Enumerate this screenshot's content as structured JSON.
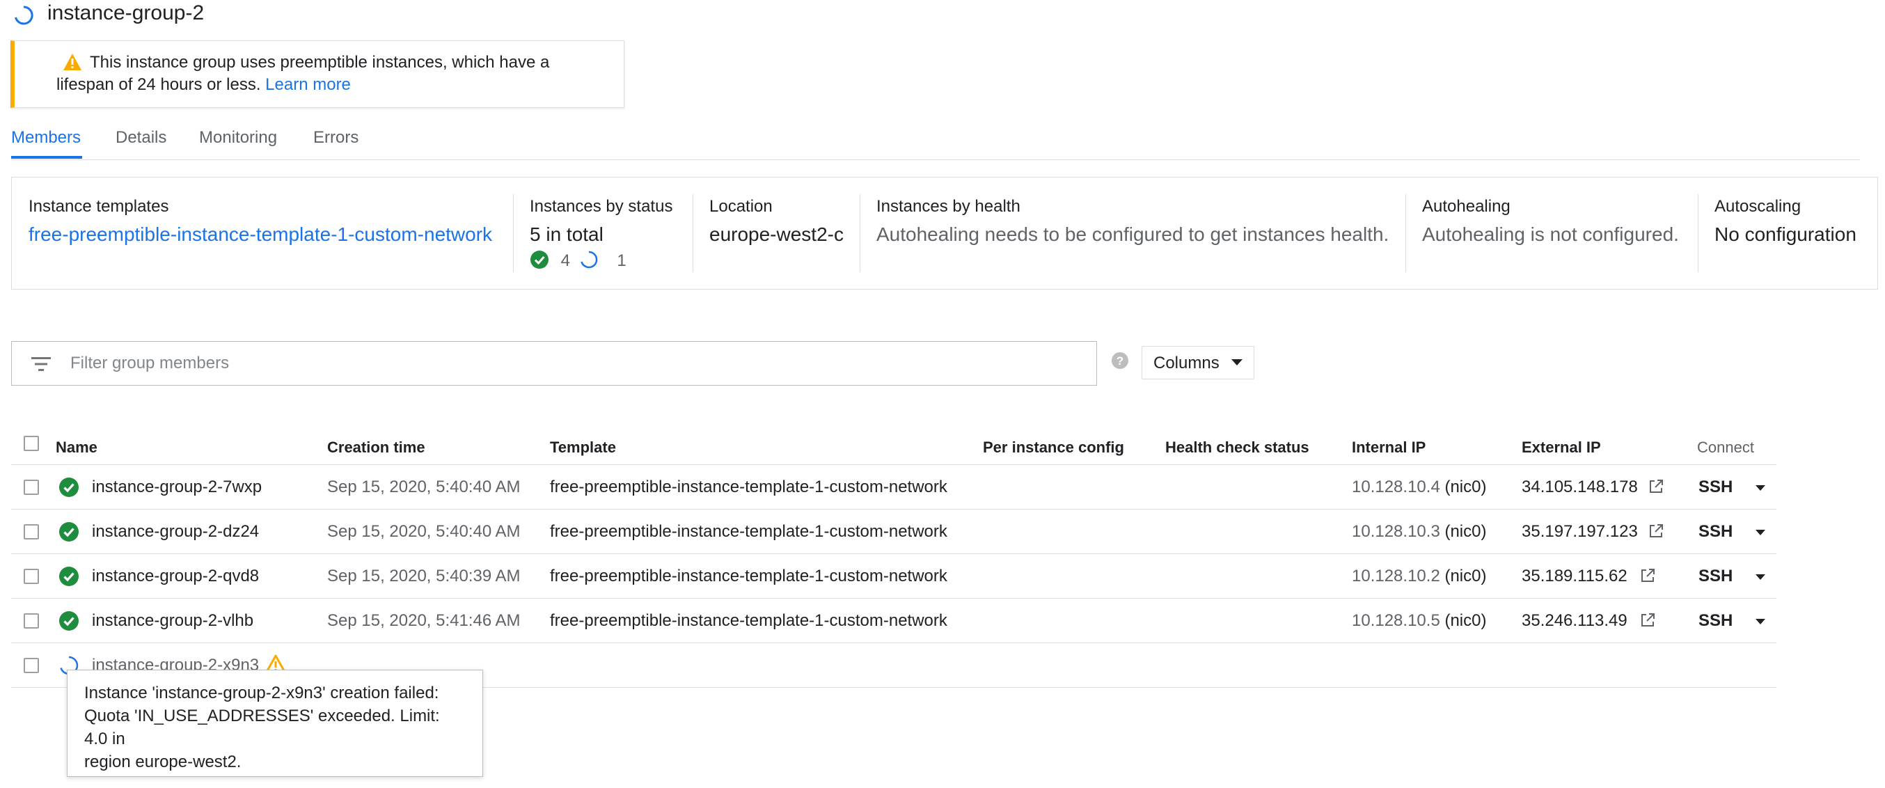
{
  "header": {
    "title": "instance-group-2",
    "status_icon": "spinner-icon"
  },
  "banner": {
    "icon": "warning-icon",
    "text_line1": "This instance group uses preemptible instances, which have a",
    "text_line2": "lifespan of 24 hours or less.",
    "link": "Learn more"
  },
  "tabs": [
    {
      "label": "Members",
      "active": true
    },
    {
      "label": "Details",
      "active": false
    },
    {
      "label": "Monitoring",
      "active": false
    },
    {
      "label": "Errors",
      "active": false
    }
  ],
  "summary": {
    "instance_templates": {
      "label": "Instance templates",
      "value": "free-preemptible-instance-template-1-custom-network"
    },
    "instances_by_status": {
      "label": "Instances by status",
      "value": "5 in total",
      "ok_count": "4",
      "pending_count": "1"
    },
    "location": {
      "label": "Location",
      "value": "europe-west2-c"
    },
    "instances_by_health": {
      "label": "Instances by health",
      "value": "Autohealing needs to be configured to get instances health."
    },
    "autohealing": {
      "label": "Autohealing",
      "value": "Autohealing is not configured."
    },
    "autoscaling": {
      "label": "Autoscaling",
      "value": "No configuration"
    }
  },
  "filter": {
    "placeholder": "Filter group members",
    "icon": "filter-icon",
    "help_icon": "help-icon"
  },
  "columns_button": {
    "label": "Columns"
  },
  "table": {
    "headers": {
      "name": "Name",
      "creation_time": "Creation time",
      "template": "Template",
      "per_instance_config": "Per instance config",
      "health_check_status": "Health check status",
      "internal_ip": "Internal IP",
      "external_ip": "External IP",
      "connect": "Connect"
    },
    "rows": [
      {
        "status": "ok",
        "name": "instance-group-2-7wxp",
        "creation_time": "Sep 15, 2020, 5:40:40 AM",
        "template": "free-preemptible-instance-template-1-custom-network",
        "internal_ip": "10.128.10.4",
        "nic": "(nic0)",
        "external_ip": "34.105.148.178",
        "connect": "SSH"
      },
      {
        "status": "ok",
        "name": "instance-group-2-dz24",
        "creation_time": "Sep 15, 2020, 5:40:40 AM",
        "template": "free-preemptible-instance-template-1-custom-network",
        "internal_ip": "10.128.10.3",
        "nic": "(nic0)",
        "external_ip": "35.197.197.123",
        "connect": "SSH"
      },
      {
        "status": "ok",
        "name": "instance-group-2-qvd8",
        "creation_time": "Sep 15, 2020, 5:40:39 AM",
        "template": "free-preemptible-instance-template-1-custom-network",
        "internal_ip": "10.128.10.2",
        "nic": "(nic0)",
        "external_ip": "35.189.115.62",
        "connect": "SSH"
      },
      {
        "status": "ok",
        "name": "instance-group-2-vlhb",
        "creation_time": "Sep 15, 2020, 5:41:46 AM",
        "template": "free-preemptible-instance-template-1-custom-network",
        "internal_ip": "10.128.10.5",
        "nic": "(nic0)",
        "external_ip": "35.246.113.49",
        "connect": "SSH"
      },
      {
        "status": "pending",
        "name": "instance-group-2-x9n3",
        "warning": true
      }
    ]
  },
  "tooltip": {
    "line1": "Instance 'instance-group-2-x9n3' creation failed:",
    "line2": "Quota 'IN_USE_ADDRESSES' exceeded. Limit: 4.0 in",
    "line3": "region europe-west2."
  },
  "colors": {
    "accent": "#1a73e8",
    "ok_green": "#1e8e3e",
    "warning": "#f9ab00",
    "text": "#202124",
    "muted": "#5f6368"
  }
}
